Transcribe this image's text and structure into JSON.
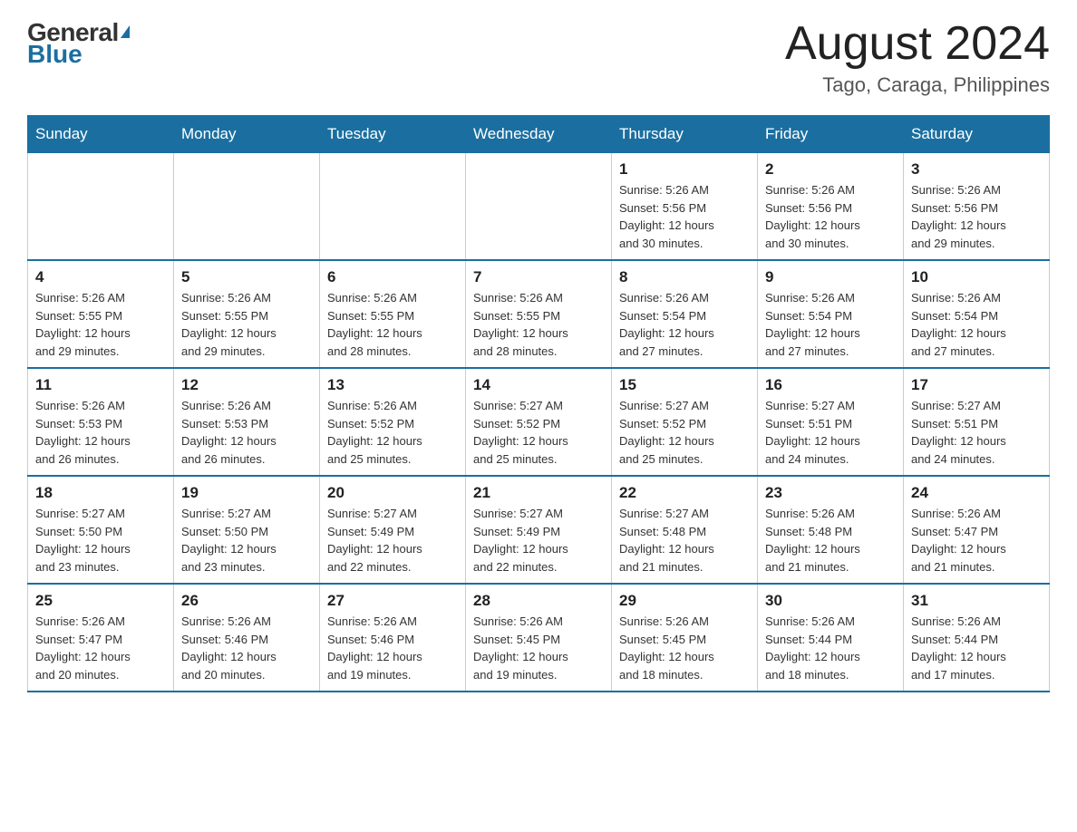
{
  "logo": {
    "general": "General",
    "blue": "Blue"
  },
  "header": {
    "month_year": "August 2024",
    "location": "Tago, Caraga, Philippines"
  },
  "weekdays": [
    "Sunday",
    "Monday",
    "Tuesday",
    "Wednesday",
    "Thursday",
    "Friday",
    "Saturday"
  ],
  "weeks": [
    [
      {
        "day": "",
        "info": ""
      },
      {
        "day": "",
        "info": ""
      },
      {
        "day": "",
        "info": ""
      },
      {
        "day": "",
        "info": ""
      },
      {
        "day": "1",
        "info": "Sunrise: 5:26 AM\nSunset: 5:56 PM\nDaylight: 12 hours\nand 30 minutes."
      },
      {
        "day": "2",
        "info": "Sunrise: 5:26 AM\nSunset: 5:56 PM\nDaylight: 12 hours\nand 30 minutes."
      },
      {
        "day": "3",
        "info": "Sunrise: 5:26 AM\nSunset: 5:56 PM\nDaylight: 12 hours\nand 29 minutes."
      }
    ],
    [
      {
        "day": "4",
        "info": "Sunrise: 5:26 AM\nSunset: 5:55 PM\nDaylight: 12 hours\nand 29 minutes."
      },
      {
        "day": "5",
        "info": "Sunrise: 5:26 AM\nSunset: 5:55 PM\nDaylight: 12 hours\nand 29 minutes."
      },
      {
        "day": "6",
        "info": "Sunrise: 5:26 AM\nSunset: 5:55 PM\nDaylight: 12 hours\nand 28 minutes."
      },
      {
        "day": "7",
        "info": "Sunrise: 5:26 AM\nSunset: 5:55 PM\nDaylight: 12 hours\nand 28 minutes."
      },
      {
        "day": "8",
        "info": "Sunrise: 5:26 AM\nSunset: 5:54 PM\nDaylight: 12 hours\nand 27 minutes."
      },
      {
        "day": "9",
        "info": "Sunrise: 5:26 AM\nSunset: 5:54 PM\nDaylight: 12 hours\nand 27 minutes."
      },
      {
        "day": "10",
        "info": "Sunrise: 5:26 AM\nSunset: 5:54 PM\nDaylight: 12 hours\nand 27 minutes."
      }
    ],
    [
      {
        "day": "11",
        "info": "Sunrise: 5:26 AM\nSunset: 5:53 PM\nDaylight: 12 hours\nand 26 minutes."
      },
      {
        "day": "12",
        "info": "Sunrise: 5:26 AM\nSunset: 5:53 PM\nDaylight: 12 hours\nand 26 minutes."
      },
      {
        "day": "13",
        "info": "Sunrise: 5:26 AM\nSunset: 5:52 PM\nDaylight: 12 hours\nand 25 minutes."
      },
      {
        "day": "14",
        "info": "Sunrise: 5:27 AM\nSunset: 5:52 PM\nDaylight: 12 hours\nand 25 minutes."
      },
      {
        "day": "15",
        "info": "Sunrise: 5:27 AM\nSunset: 5:52 PM\nDaylight: 12 hours\nand 25 minutes."
      },
      {
        "day": "16",
        "info": "Sunrise: 5:27 AM\nSunset: 5:51 PM\nDaylight: 12 hours\nand 24 minutes."
      },
      {
        "day": "17",
        "info": "Sunrise: 5:27 AM\nSunset: 5:51 PM\nDaylight: 12 hours\nand 24 minutes."
      }
    ],
    [
      {
        "day": "18",
        "info": "Sunrise: 5:27 AM\nSunset: 5:50 PM\nDaylight: 12 hours\nand 23 minutes."
      },
      {
        "day": "19",
        "info": "Sunrise: 5:27 AM\nSunset: 5:50 PM\nDaylight: 12 hours\nand 23 minutes."
      },
      {
        "day": "20",
        "info": "Sunrise: 5:27 AM\nSunset: 5:49 PM\nDaylight: 12 hours\nand 22 minutes."
      },
      {
        "day": "21",
        "info": "Sunrise: 5:27 AM\nSunset: 5:49 PM\nDaylight: 12 hours\nand 22 minutes."
      },
      {
        "day": "22",
        "info": "Sunrise: 5:27 AM\nSunset: 5:48 PM\nDaylight: 12 hours\nand 21 minutes."
      },
      {
        "day": "23",
        "info": "Sunrise: 5:26 AM\nSunset: 5:48 PM\nDaylight: 12 hours\nand 21 minutes."
      },
      {
        "day": "24",
        "info": "Sunrise: 5:26 AM\nSunset: 5:47 PM\nDaylight: 12 hours\nand 21 minutes."
      }
    ],
    [
      {
        "day": "25",
        "info": "Sunrise: 5:26 AM\nSunset: 5:47 PM\nDaylight: 12 hours\nand 20 minutes."
      },
      {
        "day": "26",
        "info": "Sunrise: 5:26 AM\nSunset: 5:46 PM\nDaylight: 12 hours\nand 20 minutes."
      },
      {
        "day": "27",
        "info": "Sunrise: 5:26 AM\nSunset: 5:46 PM\nDaylight: 12 hours\nand 19 minutes."
      },
      {
        "day": "28",
        "info": "Sunrise: 5:26 AM\nSunset: 5:45 PM\nDaylight: 12 hours\nand 19 minutes."
      },
      {
        "day": "29",
        "info": "Sunrise: 5:26 AM\nSunset: 5:45 PM\nDaylight: 12 hours\nand 18 minutes."
      },
      {
        "day": "30",
        "info": "Sunrise: 5:26 AM\nSunset: 5:44 PM\nDaylight: 12 hours\nand 18 minutes."
      },
      {
        "day": "31",
        "info": "Sunrise: 5:26 AM\nSunset: 5:44 PM\nDaylight: 12 hours\nand 17 minutes."
      }
    ]
  ]
}
